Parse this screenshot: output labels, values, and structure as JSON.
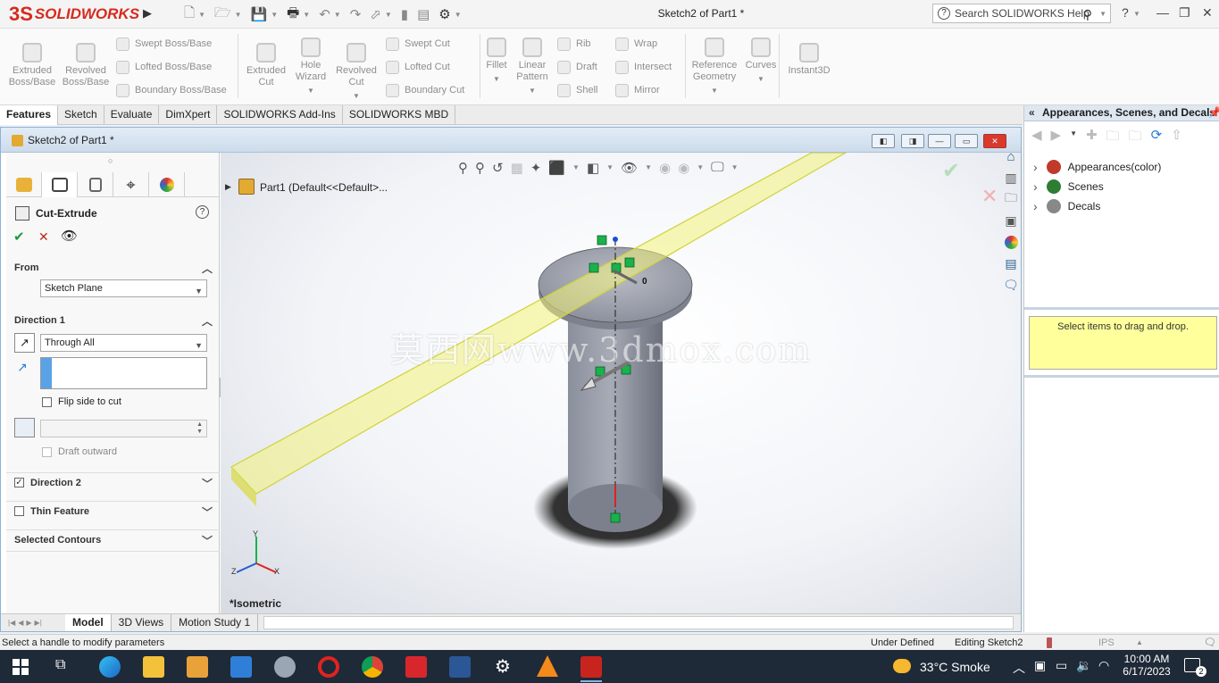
{
  "app": {
    "logo_mark": "3S",
    "logo_text": "SOLIDWORKS",
    "window_title": "Sketch2 of Part1 *",
    "search_placeholder": "Search SOLIDWORKS Help"
  },
  "ribbon": {
    "big_buttons": [
      {
        "name": "extruded-boss-button",
        "label": "Extruded\nBoss/Base"
      },
      {
        "name": "revolved-boss-button",
        "label": "Revolved\nBoss/Base"
      },
      {
        "name": "extruded-cut-button",
        "label": "Extruded\nCut"
      },
      {
        "name": "hole-wizard-button",
        "label": "Hole\nWizard"
      },
      {
        "name": "revolved-cut-button",
        "label": "Revolved\nCut"
      },
      {
        "name": "fillet-button",
        "label": "Fillet"
      },
      {
        "name": "linear-pattern-button",
        "label": "Linear\nPattern"
      },
      {
        "name": "reference-geometry-button",
        "label": "Reference\nGeometry"
      },
      {
        "name": "curves-button",
        "label": "Curves"
      },
      {
        "name": "instant3d-button",
        "label": "Instant3D"
      }
    ],
    "small_buttons": {
      "swept_boss": "Swept Boss/Base",
      "lofted_boss": "Lofted Boss/Base",
      "boundary_boss": "Boundary Boss/Base",
      "swept_cut": "Swept Cut",
      "lofted_cut": "Lofted Cut",
      "boundary_cut": "Boundary Cut",
      "rib": "Rib",
      "draft": "Draft",
      "shell": "Shell",
      "wrap": "Wrap",
      "intersect": "Intersect",
      "mirror": "Mirror"
    }
  },
  "tabs": [
    "Features",
    "Sketch",
    "Evaluate",
    "DimXpert",
    "SOLIDWORKS Add-Ins",
    "SOLIDWORKS MBD"
  ],
  "doc": {
    "title": "Sketch2 of Part1 *"
  },
  "property_manager": {
    "title": "Cut-Extrude",
    "help": "?",
    "from_section": "From",
    "from_value": "Sketch Plane",
    "direction1": "Direction 1",
    "end_condition": "Through All",
    "flip_side": "Flip side to cut",
    "draft_outward": "Draft outward",
    "direction2": "Direction 2",
    "thin_feature": "Thin Feature",
    "selected_contours": "Selected Contours"
  },
  "viewport": {
    "tree_label": "Part1  (Default<<Default>...",
    "view_label": "*Isometric",
    "watermark": "莫西网www.3dmox.com",
    "triad": {
      "x": "X",
      "y": "Y",
      "z": "Z"
    },
    "dim_label": "0"
  },
  "bottom_tabs": [
    "Model",
    "3D Views",
    "Motion Study 1"
  ],
  "task_pane": {
    "title": "Appearances, Scenes, and Decals",
    "items": [
      {
        "label": "Appearances(color)",
        "color": "#c0392b"
      },
      {
        "label": "Scenes",
        "color": "#2e7d32"
      },
      {
        "label": "Decals",
        "color": "#888888"
      }
    ],
    "hint": "Select items to drag and drop."
  },
  "status": {
    "message": "Select a handle to modify parameters",
    "state": "Under Defined",
    "editing": "Editing Sketch2",
    "units": "IPS"
  },
  "taskbar": {
    "weather": "33°C  Smoke",
    "time": "10:00 AM",
    "date": "6/17/2023",
    "notif": "2"
  },
  "colors": {
    "accent": "#d52b1e",
    "pane_header": "#dfe7f1",
    "sketch_green": "#19b24b",
    "highlight_yellow": "#f3f37a"
  }
}
